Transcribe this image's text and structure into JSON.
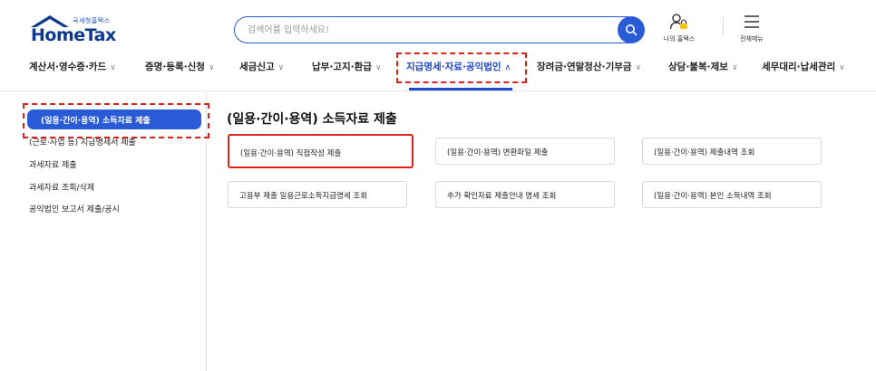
{
  "header": {
    "logo_sub": "국세청홈택스",
    "logo_main": "HomeTax",
    "search_placeholder": "검색어를 입력하세요!",
    "my_hometax_label": "나의 홈택스",
    "all_menu_label": "전체메뉴"
  },
  "nav": {
    "items": [
      {
        "label": "계산서·영수증·카드"
      },
      {
        "label": "증명·등록·신청"
      },
      {
        "label": "세금신고"
      },
      {
        "label": "납부·고지·환급"
      },
      {
        "label": "지급명세·자료·공익법인"
      },
      {
        "label": "장려금·연말정산·기부금"
      },
      {
        "label": "상담·불복·제보"
      },
      {
        "label": "세무대리·납세관리"
      }
    ],
    "active_index": 4
  },
  "sidebar": {
    "items": [
      {
        "label": "(일용·간이·용역) 소득자료 제출"
      },
      {
        "label": "(근로·사업 등) 지급명세서 제출"
      },
      {
        "label": "과세자료 제출"
      },
      {
        "label": "과세자료 조회/삭제"
      },
      {
        "label": "공익법인 보고서 제출/공시"
      }
    ],
    "active_index": 0
  },
  "main": {
    "title": "(일용·간이·용역) 소득자료 제출",
    "cards": [
      {
        "label": "(일용·간이·용역) 직접작성 제출"
      },
      {
        "label": "(일용·간이·용역) 변환파일 제출"
      },
      {
        "label": "(일용·간이·용역) 제출내역 조회"
      },
      {
        "label": "고용부 제출 일용근로소득지급명세 조회"
      },
      {
        "label": "추가 확인자료 제출안내 명세 조회"
      },
      {
        "label": "(일용·간이·용역) 본인 소득내역 조회"
      }
    ]
  },
  "colors": {
    "brand": "#2a5bd7",
    "nav_active": "#1f47c9",
    "highlight": "#e0201b"
  }
}
